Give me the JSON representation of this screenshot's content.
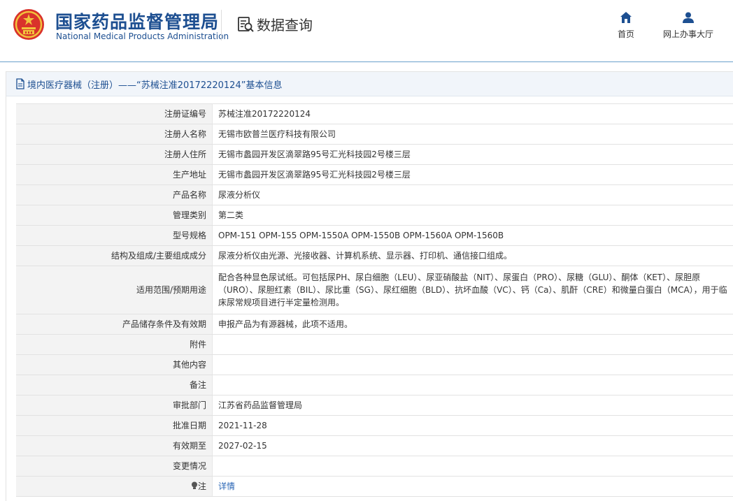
{
  "header": {
    "title_cn": "国家药品监督管理局",
    "title_en": "National Medical Products Administration",
    "search_title": "数据查询",
    "nav": {
      "home": "首页",
      "online_hall": "网上办事大厅"
    }
  },
  "panel": {
    "title": "境内医疗器械（注册）——“苏械注准20172220124”基本信息"
  },
  "rows": [
    {
      "label": "注册证编号",
      "value": "苏械注准20172220124"
    },
    {
      "label": "注册人名称",
      "value": "无锡市欧普兰医疗科技有限公司"
    },
    {
      "label": "注册人住所",
      "value": "无锡市蠡园开发区滴翠路95号汇光科技园2号楼三层"
    },
    {
      "label": "生产地址",
      "value": "无锡市蠡园开发区滴翠路95号汇光科技园2号楼三层"
    },
    {
      "label": "产品名称",
      "value": "尿液分析仪"
    },
    {
      "label": "管理类别",
      "value": "第二类"
    },
    {
      "label": "型号规格",
      "value": "OPM-151 OPM-155 OPM-1550A OPM-1550B OPM-1560A OPM-1560B"
    },
    {
      "label": "结构及组成/主要组成成分",
      "value": "尿液分析仪由光源、光接收器、计算机系统、显示器、打印机、通信接口组成。"
    },
    {
      "label": "适用范围/预期用途",
      "value": "配合各种显色尿试纸。可包括尿PH、尿白细胞（LEU）、尿亚硝酸盐（NIT）、尿蛋白（PRO）、尿糖（GLU）、酮体（KET）、尿胆原（URO）、尿胆红素（BIL）、尿比重（SG）、尿红细胞（BLD）、抗坏血酸（VC）、钙（Ca）、肌酐（CRE）和微量白蛋白（MCA），用于临床尿常规项目进行半定量检测用。"
    },
    {
      "label": "产品储存条件及有效期",
      "value": "申报产品为有源器械，此项不适用。"
    },
    {
      "label": "附件",
      "value": ""
    },
    {
      "label": "其他内容",
      "value": ""
    },
    {
      "label": "备注",
      "value": ""
    },
    {
      "label": "审批部门",
      "value": "江苏省药品监督管理局"
    },
    {
      "label": "批准日期",
      "value": "2021-11-28"
    },
    {
      "label": "有效期至",
      "value": "2027-02-15"
    },
    {
      "label": "变更情况",
      "value": ""
    },
    {
      "label": "注",
      "value": "详情"
    }
  ],
  "colors": {
    "brand_blue": "#1d4f91",
    "link_blue": "#2a66b5",
    "label_bg": "#f3f3f3",
    "panel_head_bg": "#f1f5fa"
  },
  "icons": {
    "emblem": "national-emblem",
    "search": "data-search-icon",
    "home": "home-icon",
    "user": "user-icon",
    "doc": "document-icon",
    "note": "lightbulb-icon"
  }
}
